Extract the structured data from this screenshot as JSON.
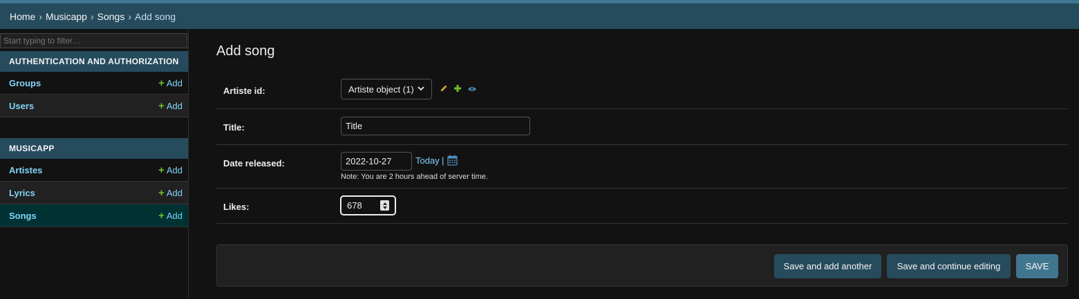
{
  "breadcrumbs": {
    "home": "Home",
    "app": "Musicapp",
    "model": "Songs",
    "current": "Add song",
    "separator": "›"
  },
  "sidebar": {
    "filter_placeholder": "Start typing to filter…",
    "modules": [
      {
        "caption": "AUTHENTICATION AND AUTHORIZATION",
        "models": [
          {
            "name": "Groups",
            "add_label": "Add"
          },
          {
            "name": "Users",
            "add_label": "Add"
          }
        ]
      },
      {
        "caption": "MUSICAPP",
        "models": [
          {
            "name": "Artistes",
            "add_label": "Add"
          },
          {
            "name": "Lyrics",
            "add_label": "Add"
          },
          {
            "name": "Songs",
            "add_label": "Add",
            "selected": true
          }
        ]
      }
    ]
  },
  "form": {
    "title": "Add song",
    "artiste": {
      "label": "Artiste id:",
      "selected": "Artiste object (1)"
    },
    "title_field": {
      "label": "Title:",
      "value": "Title"
    },
    "date_released": {
      "label": "Date released:",
      "value": "2022-10-27",
      "today_label": "Today",
      "separator": "|",
      "help": "Note: You are 2 hours ahead of server time."
    },
    "likes": {
      "label": "Likes:",
      "value": "678"
    }
  },
  "submit": {
    "save_add_another": "Save and add another",
    "save_continue": "Save and continue editing",
    "save": "SAVE"
  },
  "colors": {
    "header": "#264b5d",
    "accent": "#417690",
    "link": "#81d4fa",
    "add_green": "#70bf2b",
    "selected_row": "#003133",
    "background": "#121212"
  }
}
